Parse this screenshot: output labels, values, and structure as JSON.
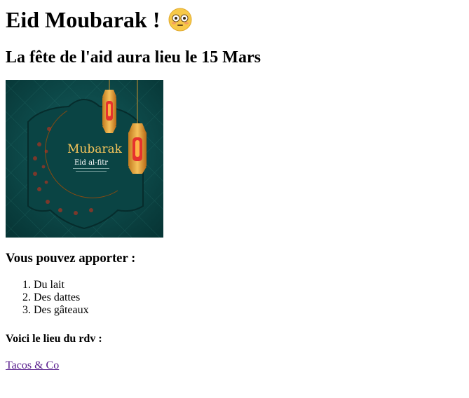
{
  "heading": {
    "title": "Eid Moubarak !",
    "emoji_icon": "flushed-face-icon"
  },
  "subheading": "La fête de l'aid aura lieu le 15 Mars",
  "banner": {
    "title_line1": "Mubarak",
    "title_line2": "Eid al-fitr",
    "colors": {
      "background": "#0d4a4a",
      "gold": "#e8a33a",
      "moon": "#f0b440"
    }
  },
  "bring_heading": "Vous pouvez apporter :",
  "bring_items": [
    "Du lait",
    "Des dattes",
    "Des gâteaux"
  ],
  "location_heading": "Voici le lieu du rdv :",
  "location_link": "Tacos & Co"
}
